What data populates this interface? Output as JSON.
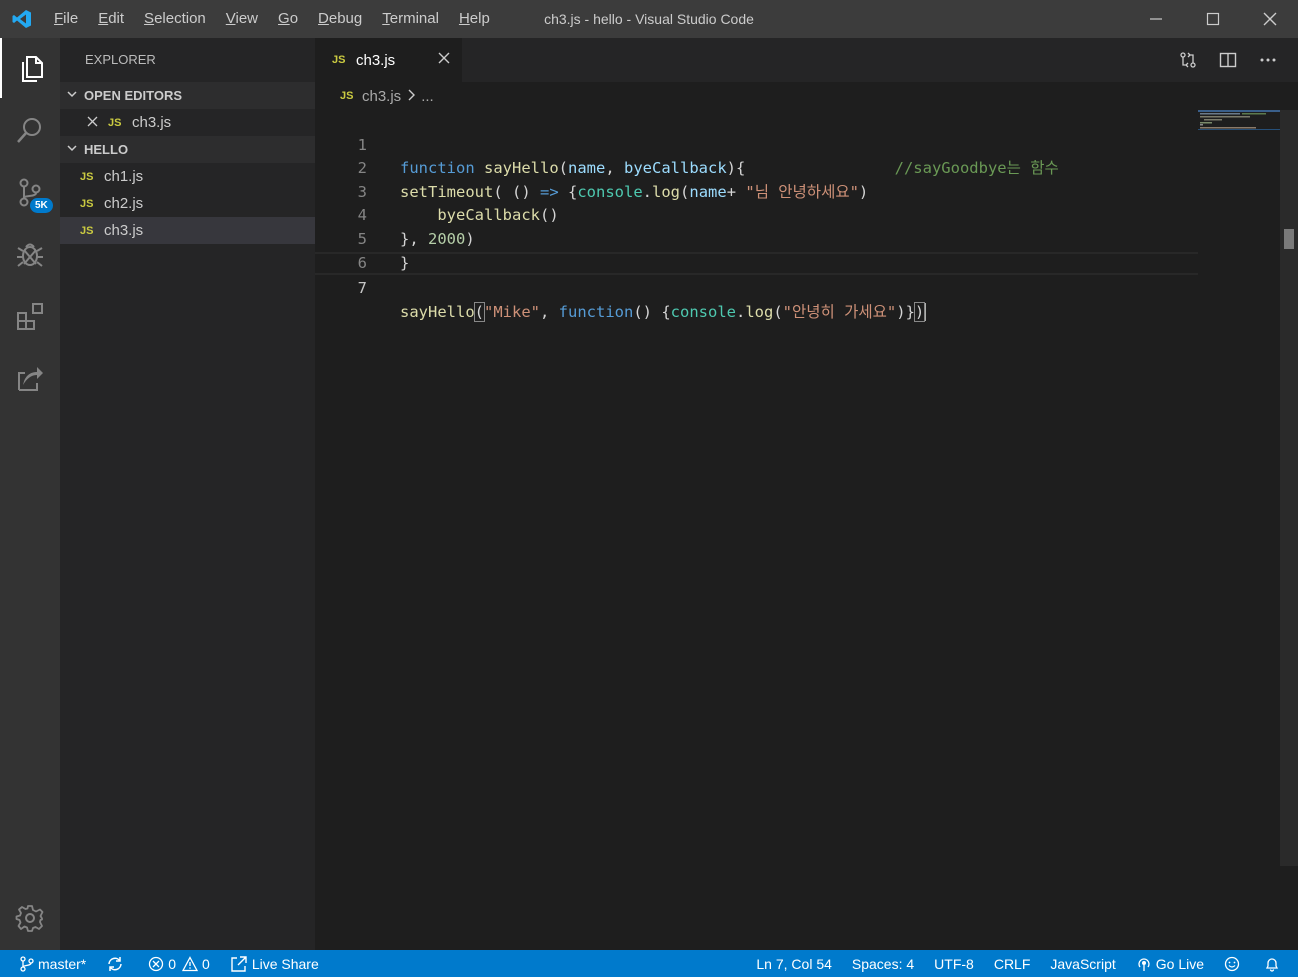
{
  "window": {
    "title": "ch3.js - hello - Visual Studio Code"
  },
  "menu": [
    {
      "first": "F",
      "rest": "ile"
    },
    {
      "first": "E",
      "rest": "dit"
    },
    {
      "first": "S",
      "rest": "election"
    },
    {
      "first": "V",
      "rest": "iew"
    },
    {
      "first": "G",
      "rest": "o"
    },
    {
      "first": "D",
      "rest": "ebug"
    },
    {
      "first": "T",
      "rest": "erminal"
    },
    {
      "first": "H",
      "rest": "elp"
    }
  ],
  "activity": {
    "scm_badge": "5K",
    "items": [
      "explorer-icon",
      "search-icon",
      "source-control-icon",
      "debug-icon",
      "extensions-icon",
      "live-share-icon",
      "settings-gear-icon"
    ]
  },
  "explorer": {
    "title": "EXPLORER",
    "open_editors_label": "OPEN EDITORS",
    "open_editors": [
      {
        "icon": "JS",
        "name": "ch3.js"
      }
    ],
    "folder_label": "HELLO",
    "files": [
      {
        "icon": "JS",
        "name": "ch1.js"
      },
      {
        "icon": "JS",
        "name": "ch2.js"
      },
      {
        "icon": "JS",
        "name": "ch3.js"
      }
    ]
  },
  "tab": {
    "icon": "JS",
    "name": "ch3.js"
  },
  "breadcrumb": {
    "icon": "JS",
    "file": "ch3.js",
    "more": "..."
  },
  "code": {
    "line_numbers": [
      "1",
      "2",
      "3",
      "4",
      "5",
      "6",
      "7"
    ],
    "line1": {
      "kw": "function",
      "fn": "sayHello",
      "p1": "(",
      "a1": "name",
      "c1": ", ",
      "a2": "byeCallback",
      "p2": "){",
      "gap": "                ",
      "comment": "//sayGoodbye는 함수"
    },
    "line2": {
      "fn": "setTimeout",
      "p1": "( () ",
      "arrow": "=>",
      "p2": " {",
      "obj": "console",
      "dot": ".",
      "m": "log",
      "p3": "(",
      "a": "name",
      "plus": "+ ",
      "s": "\"님 안녕하세요\"",
      "p4": ")"
    },
    "line3": {
      "indent": "    ",
      "fn": "byeCallback",
      "p": "()"
    },
    "line4": {
      "p1": "}, ",
      "n": "2000",
      "p2": ")"
    },
    "line5": {
      "p": "}"
    },
    "line7": {
      "fn": "sayHello",
      "b1": "(",
      "s1": "\"Mike\"",
      "c": ", ",
      "kw": "function",
      "p1": "() {",
      "obj": "console",
      "dot": ".",
      "m": "log",
      "p2": "(",
      "s2": "\"안녕히 가세요\"",
      "p3": ")}",
      "b2": ")"
    }
  },
  "status": {
    "branch": "master*",
    "errors": "0",
    "warnings": "0",
    "live_share": "Live Share",
    "position": "Ln 7, Col 54",
    "spaces": "Spaces: 4",
    "encoding": "UTF-8",
    "eol": "CRLF",
    "language": "JavaScript",
    "go_live": "Go Live"
  }
}
